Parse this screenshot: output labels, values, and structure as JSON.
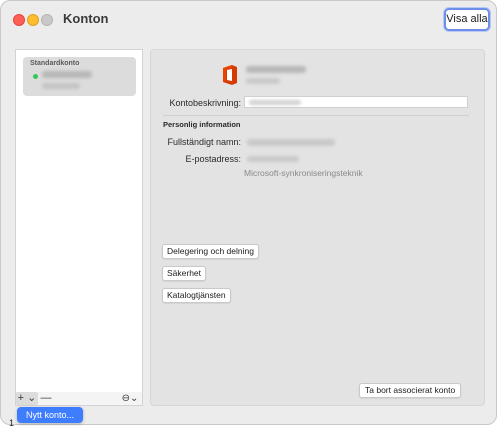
{
  "window": {
    "title": "Konton",
    "show_all_label": "Visa alla"
  },
  "accounts": {
    "header": "Standardkonto",
    "items": [
      {
        "status": "online"
      }
    ],
    "add_symbol": "+ ⌄",
    "remove_symbol": "—",
    "more_symbol": "⊖⌄",
    "menu_item": "Nytt konto..."
  },
  "detail": {
    "description_label": "Kontobeskrivning:",
    "section_title": "Personlig information",
    "fullname_label": "Fullständigt namn:",
    "email_label": "E-postadress:",
    "sync_text": "Microsoft-synkroniseringsteknik",
    "buttons": {
      "delegation": "Delegering och delning",
      "security": "Säkerhet",
      "directory": "Katalogtjänsten",
      "remove": "Ta bort associerat konto"
    }
  },
  "stray_text": "1",
  "colors": {
    "accent": "#3f7dff",
    "online": "#34c759",
    "close": "#ff5f57",
    "minimize": "#febc2e",
    "office_red": "#d83b01"
  },
  "icons": [
    "office-logo-icon",
    "status-online-icon",
    "add-icon",
    "remove-icon",
    "more-options-icon"
  ]
}
